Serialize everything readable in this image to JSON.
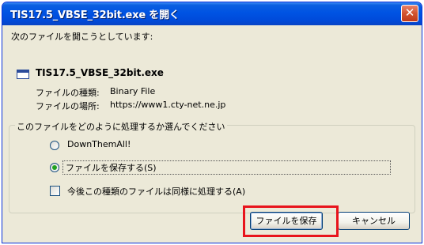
{
  "window": {
    "title": "TIS17.5_VBSE_32bit.exe を開く",
    "close_label": "✕"
  },
  "dialog": {
    "intro": "次のファイルを開こうとしています:",
    "file_name": "TIS17.5_VBSE_32bit.exe",
    "file_type_label": "ファイルの種類:",
    "file_type_value": "Binary File",
    "file_location_label": "ファイルの場所:",
    "file_location_value": "https://www1.cty-net.ne.jp",
    "group_label": "このファイルをどのように処理するか選んでください",
    "options": [
      {
        "label": "DownThemAll!",
        "selected": false
      },
      {
        "label": "ファイルを保存する(S)",
        "selected": true
      }
    ],
    "checkbox_label": "今後この種類のファイルは同様に処理する(A)",
    "checkbox_checked": false
  },
  "buttons": {
    "save_label": "ファイルを保存",
    "cancel_label": "キャンセル"
  },
  "colors": {
    "titlebar": "#0053e3",
    "dialog_bg": "#ece9d8",
    "highlight": "#e8141c",
    "radio_dot": "#21a121"
  }
}
